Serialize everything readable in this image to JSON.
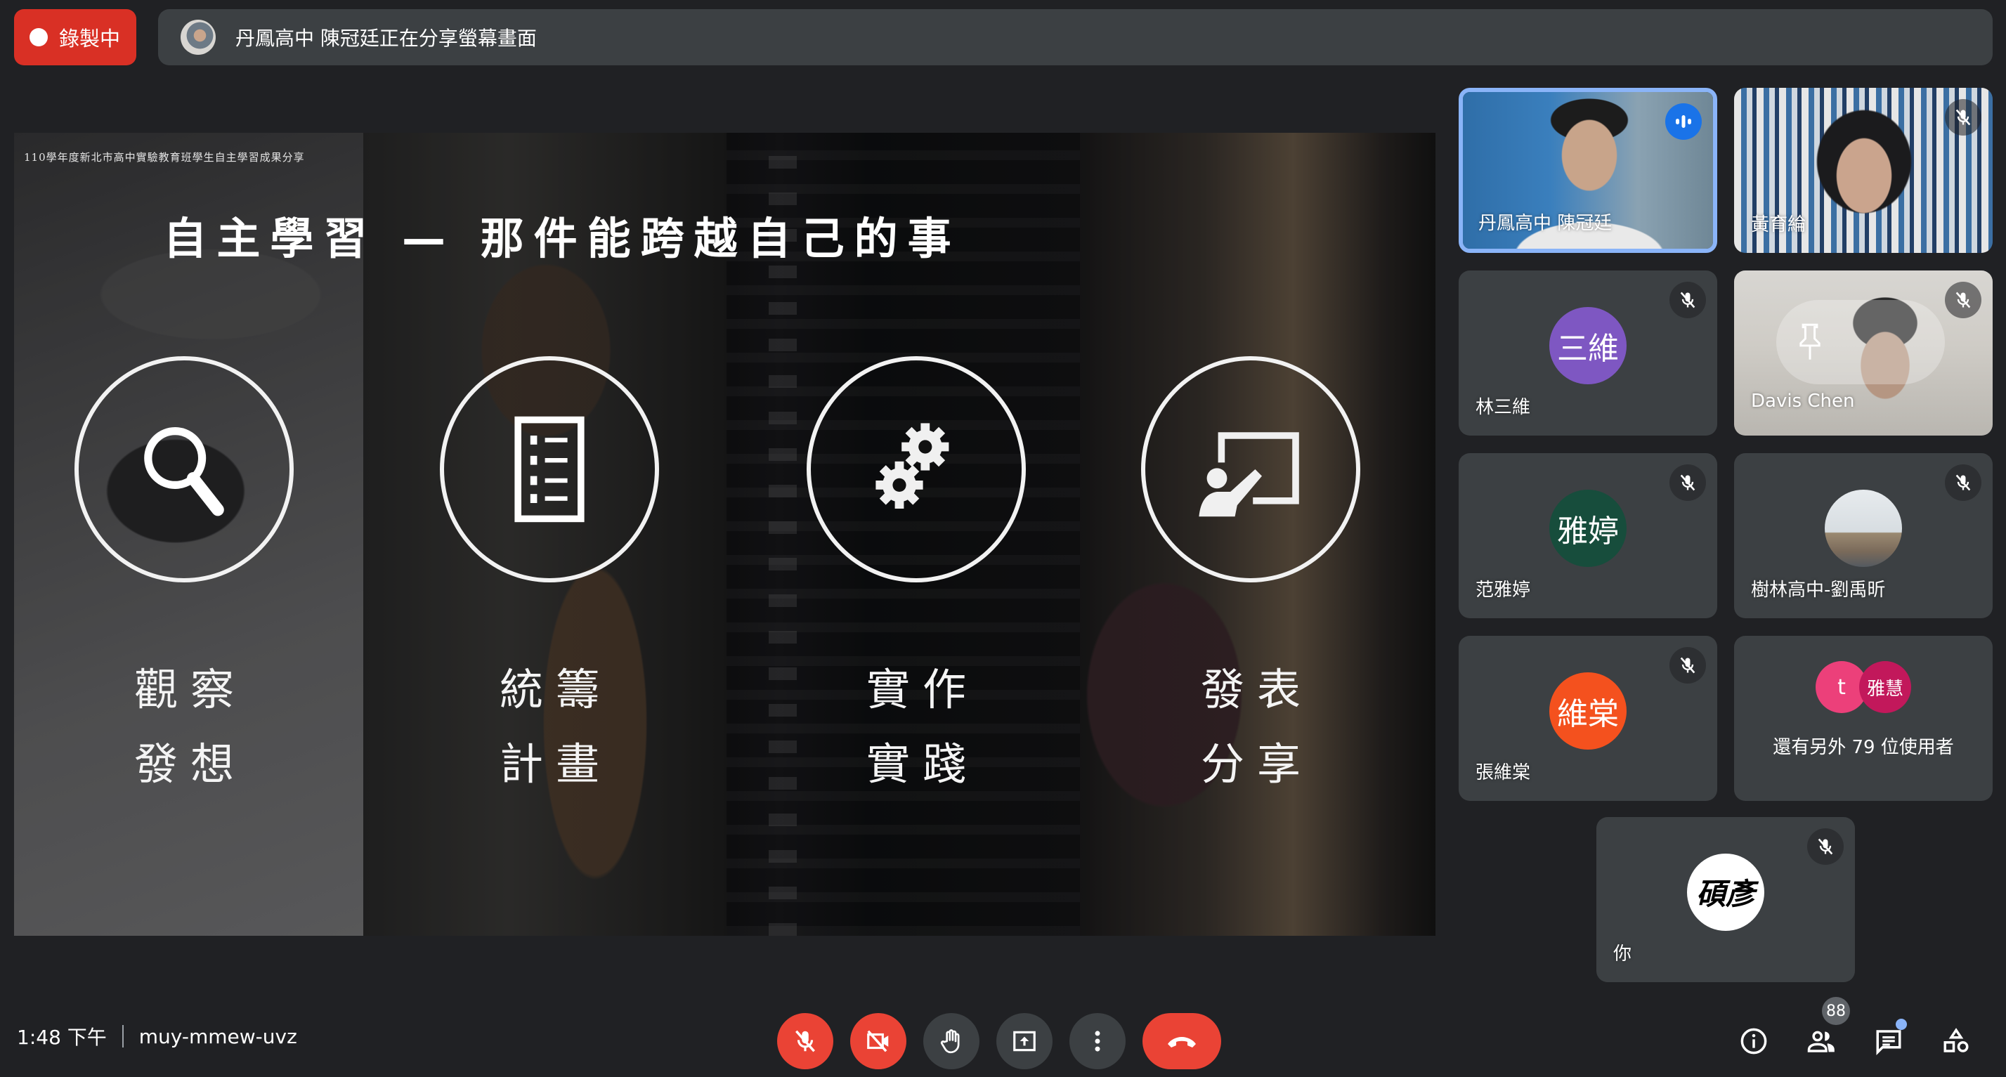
{
  "recording": {
    "label": "錄製中",
    "color": "#d93025"
  },
  "share_banner": {
    "text": "丹鳳高中 陳冠廷正在分享螢幕畫面"
  },
  "slide": {
    "caption": "110學年度新北市高中實驗教育班學生自主學習成果分享",
    "title": "自主學習 — 那件能跨越自己的事",
    "steps": [
      {
        "icon": "magnifier-icon",
        "line1": "觀察",
        "line2": "發想"
      },
      {
        "icon": "checklist-icon",
        "line1": "統籌",
        "line2": "計畫"
      },
      {
        "icon": "gears-icon",
        "line1": "實作",
        "line2": "實踐"
      },
      {
        "icon": "presenter-icon",
        "line1": "發表",
        "line2": "分享"
      }
    ]
  },
  "participants": [
    {
      "name": "丹鳳高中 陳冠廷",
      "type": "video",
      "speaking": true,
      "muted": false
    },
    {
      "name": "黃育綸",
      "type": "video",
      "muted": true
    },
    {
      "name": "林三維",
      "type": "initials",
      "initials": "三維",
      "avatar_color": "#7e57c2",
      "muted": true
    },
    {
      "name": "Davis Chen",
      "type": "video",
      "muted": true,
      "pin_overlay": true
    },
    {
      "name": "范雅婷",
      "type": "initials",
      "initials": "雅婷",
      "avatar_color": "#174d3c",
      "muted": true
    },
    {
      "name": "樹林高中-劉禹昕",
      "type": "photo",
      "muted": true
    },
    {
      "name": "張維棠",
      "type": "initials",
      "initials": "維棠",
      "avatar_color": "#f4511e",
      "muted": true
    }
  ],
  "more_participants": {
    "avatars": [
      {
        "initials": "t",
        "color": "#ec407a"
      },
      {
        "initials": "雅慧",
        "color": "#c2185b"
      }
    ],
    "text": "還有另外 79 位使用者"
  },
  "self": {
    "name": "你",
    "avatar_text": "碩彥",
    "muted": true
  },
  "bottom_bar": {
    "time": "1:48 下午",
    "meeting_code": "muy-mmew-uvz",
    "controls": [
      {
        "name": "microphone-off",
        "state": "off"
      },
      {
        "name": "camera-off",
        "state": "off"
      },
      {
        "name": "raise-hand"
      },
      {
        "name": "present-now"
      },
      {
        "name": "more-options"
      },
      {
        "name": "leave-call"
      }
    ],
    "people_count": "88",
    "chat_has_unread": true
  },
  "colors": {
    "danger": "#ea4335",
    "accent": "#8ab4f8",
    "tile": "#3c4043",
    "background": "#202124"
  }
}
